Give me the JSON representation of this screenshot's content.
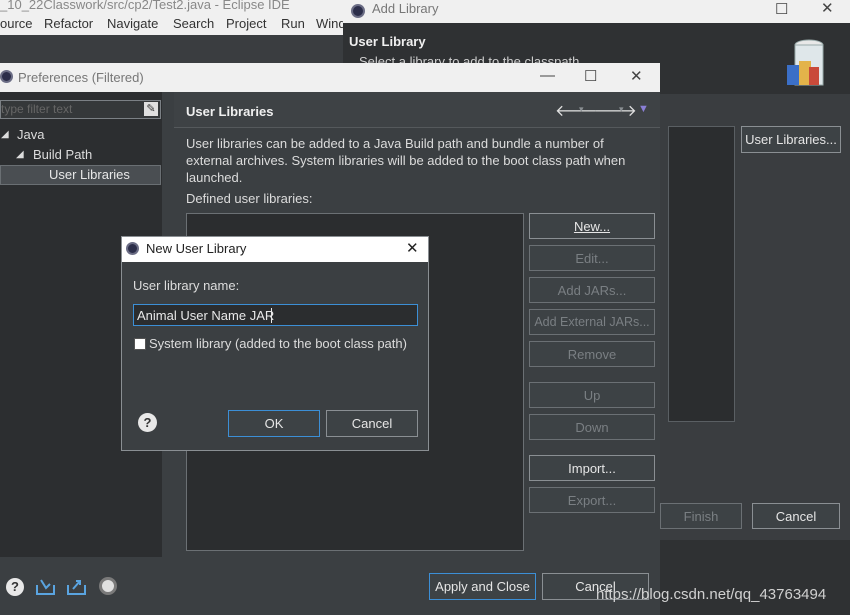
{
  "eclipse": {
    "title": "_10_22Classwork/src/cp2/Test2.java - Eclipse IDE",
    "menu": [
      "ource",
      "Refactor",
      "Navigate",
      "Search",
      "Project",
      "Run",
      "Wind"
    ]
  },
  "add_library": {
    "title": "Add Library",
    "heading": "User Library",
    "subtext": "Select a library to add to the classpath.",
    "user_libraries_button": "User Libraries...",
    "finish_button": "Finish",
    "cancel_button": "Cancel"
  },
  "preferences": {
    "title": "Preferences (Filtered)",
    "filter_placeholder": "type filter text",
    "tree": {
      "java": "Java",
      "build_path": "Build Path",
      "user_libraries": "User Libraries"
    },
    "page_title": "User Libraries",
    "description": "User libraries can be added to a Java Build path and bundle a number of external archives. System libraries will be added to the boot class path when launched.",
    "defined_label": "Defined user libraries:",
    "buttons": {
      "new": "New...",
      "edit": "Edit...",
      "add_jars": "Add JARs...",
      "add_external_jars": "Add External JARs...",
      "remove": "Remove",
      "up": "Up",
      "down": "Down",
      "import": "Import...",
      "export": "Export..."
    },
    "apply_close": "Apply and Close",
    "cancel": "Cancel"
  },
  "new_user_library": {
    "title": "New User Library",
    "name_label": "User library name:",
    "name_value": "Animal User Name JAR",
    "system_library_label": "System library (added to the boot class path)",
    "ok": "OK",
    "cancel": "Cancel"
  },
  "watermark": "https://blog.csdn.net/qq_43763494",
  "colors": {
    "dark_bg": "#2f3133",
    "panel_bg": "#3b3f42",
    "light_chrome": "#f0f0f0",
    "focus_border": "#3c8fd6"
  }
}
